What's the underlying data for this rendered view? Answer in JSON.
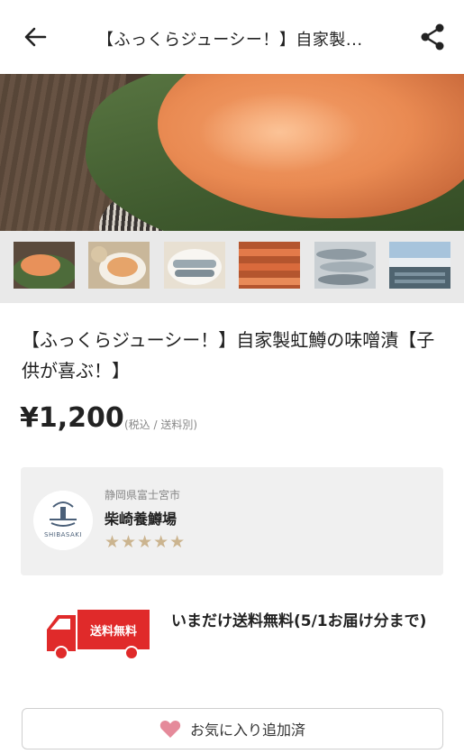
{
  "header": {
    "title": "【ふっくらジューシー！】自家製..."
  },
  "product": {
    "title": "【ふっくらジューシー！】自家製虹鱒の味噌漬【子供が喜ぶ！】",
    "price": "¥1,200",
    "price_note": "(税込 / 送料別)"
  },
  "shop": {
    "region": "静岡県富士宮市",
    "name": "柴崎養鱒場",
    "stars": "★★★★★",
    "rating": 5,
    "logo_text": "SHIBASAKI"
  },
  "shipping": {
    "badge": "送料無料",
    "text": "いまだけ送料無料(5/1お届け分まで)"
  },
  "favorite": {
    "label": "お気に入り追加済"
  },
  "colors": {
    "accent_red": "#e02a2a",
    "star": "#cbb48f",
    "heart": "#e58a9a"
  }
}
